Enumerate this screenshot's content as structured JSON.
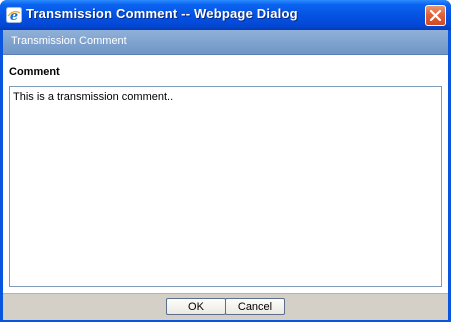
{
  "window": {
    "title": "Transmission Comment -- Webpage Dialog",
    "app_icon": "ie-icon",
    "close_icon": "close-icon",
    "colors": {
      "titlebar": "#0553e3",
      "banner": "#7fa2cf",
      "footer": "#d4d0c8",
      "close_button": "#e0613c"
    }
  },
  "banner": {
    "title": "Transmission Comment"
  },
  "form": {
    "comment_label": "Comment",
    "comment_value": "This is a transmission comment.."
  },
  "buttons": {
    "ok_label": "OK",
    "cancel_label": "Cancel"
  }
}
